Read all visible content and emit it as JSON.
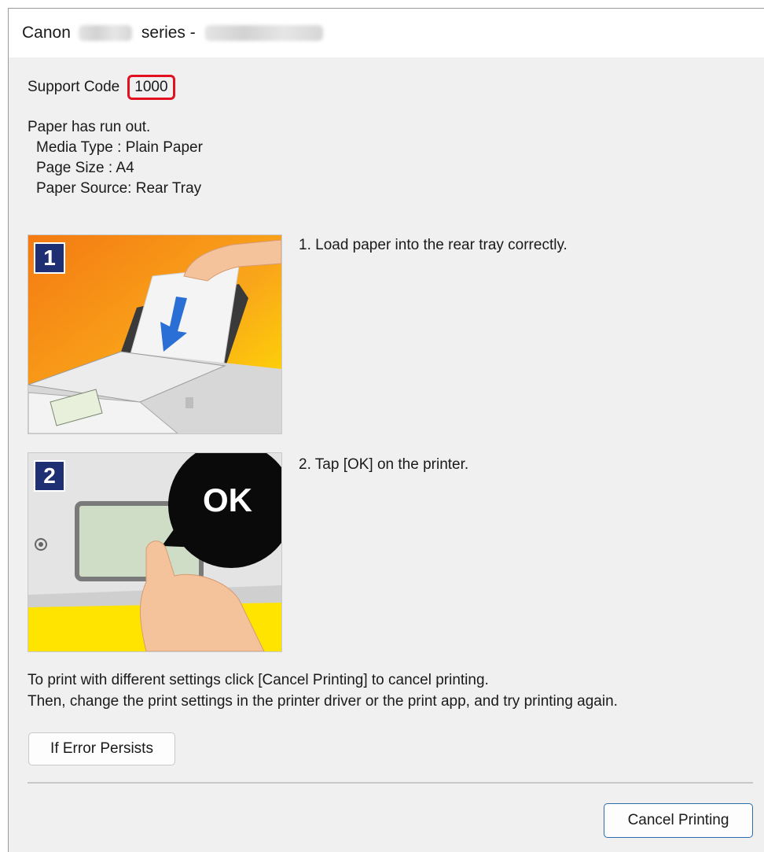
{
  "window": {
    "title_prefix": "Canon",
    "title_middle": "series -"
  },
  "support": {
    "label": "Support Code",
    "code": "1000"
  },
  "message": {
    "line1": "Paper has run out.",
    "media_type": "Media Type : Plain Paper",
    "page_size": "Page Size : A4",
    "paper_source": "Paper Source: Rear Tray"
  },
  "steps": [
    {
      "badge": "1",
      "text": "1.  Load paper into the rear tray correctly."
    },
    {
      "badge": "2",
      "text": "2.  Tap [OK] on the printer.",
      "bubble": "OK"
    }
  ],
  "note": {
    "line1": "To print with different settings click [Cancel Printing] to cancel printing.",
    "line2": "Then, change the print settings in the printer driver or the print app, and try printing again."
  },
  "buttons": {
    "error_persists": "If Error Persists",
    "cancel_printing": "Cancel Printing"
  },
  "colors": {
    "code_highlight": "#e31020",
    "badge_bg": "#1f2f73",
    "illustration_orange": "#f7941d",
    "illustration_yellow": "#ffe100",
    "arrow_blue": "#2a6fd6"
  }
}
